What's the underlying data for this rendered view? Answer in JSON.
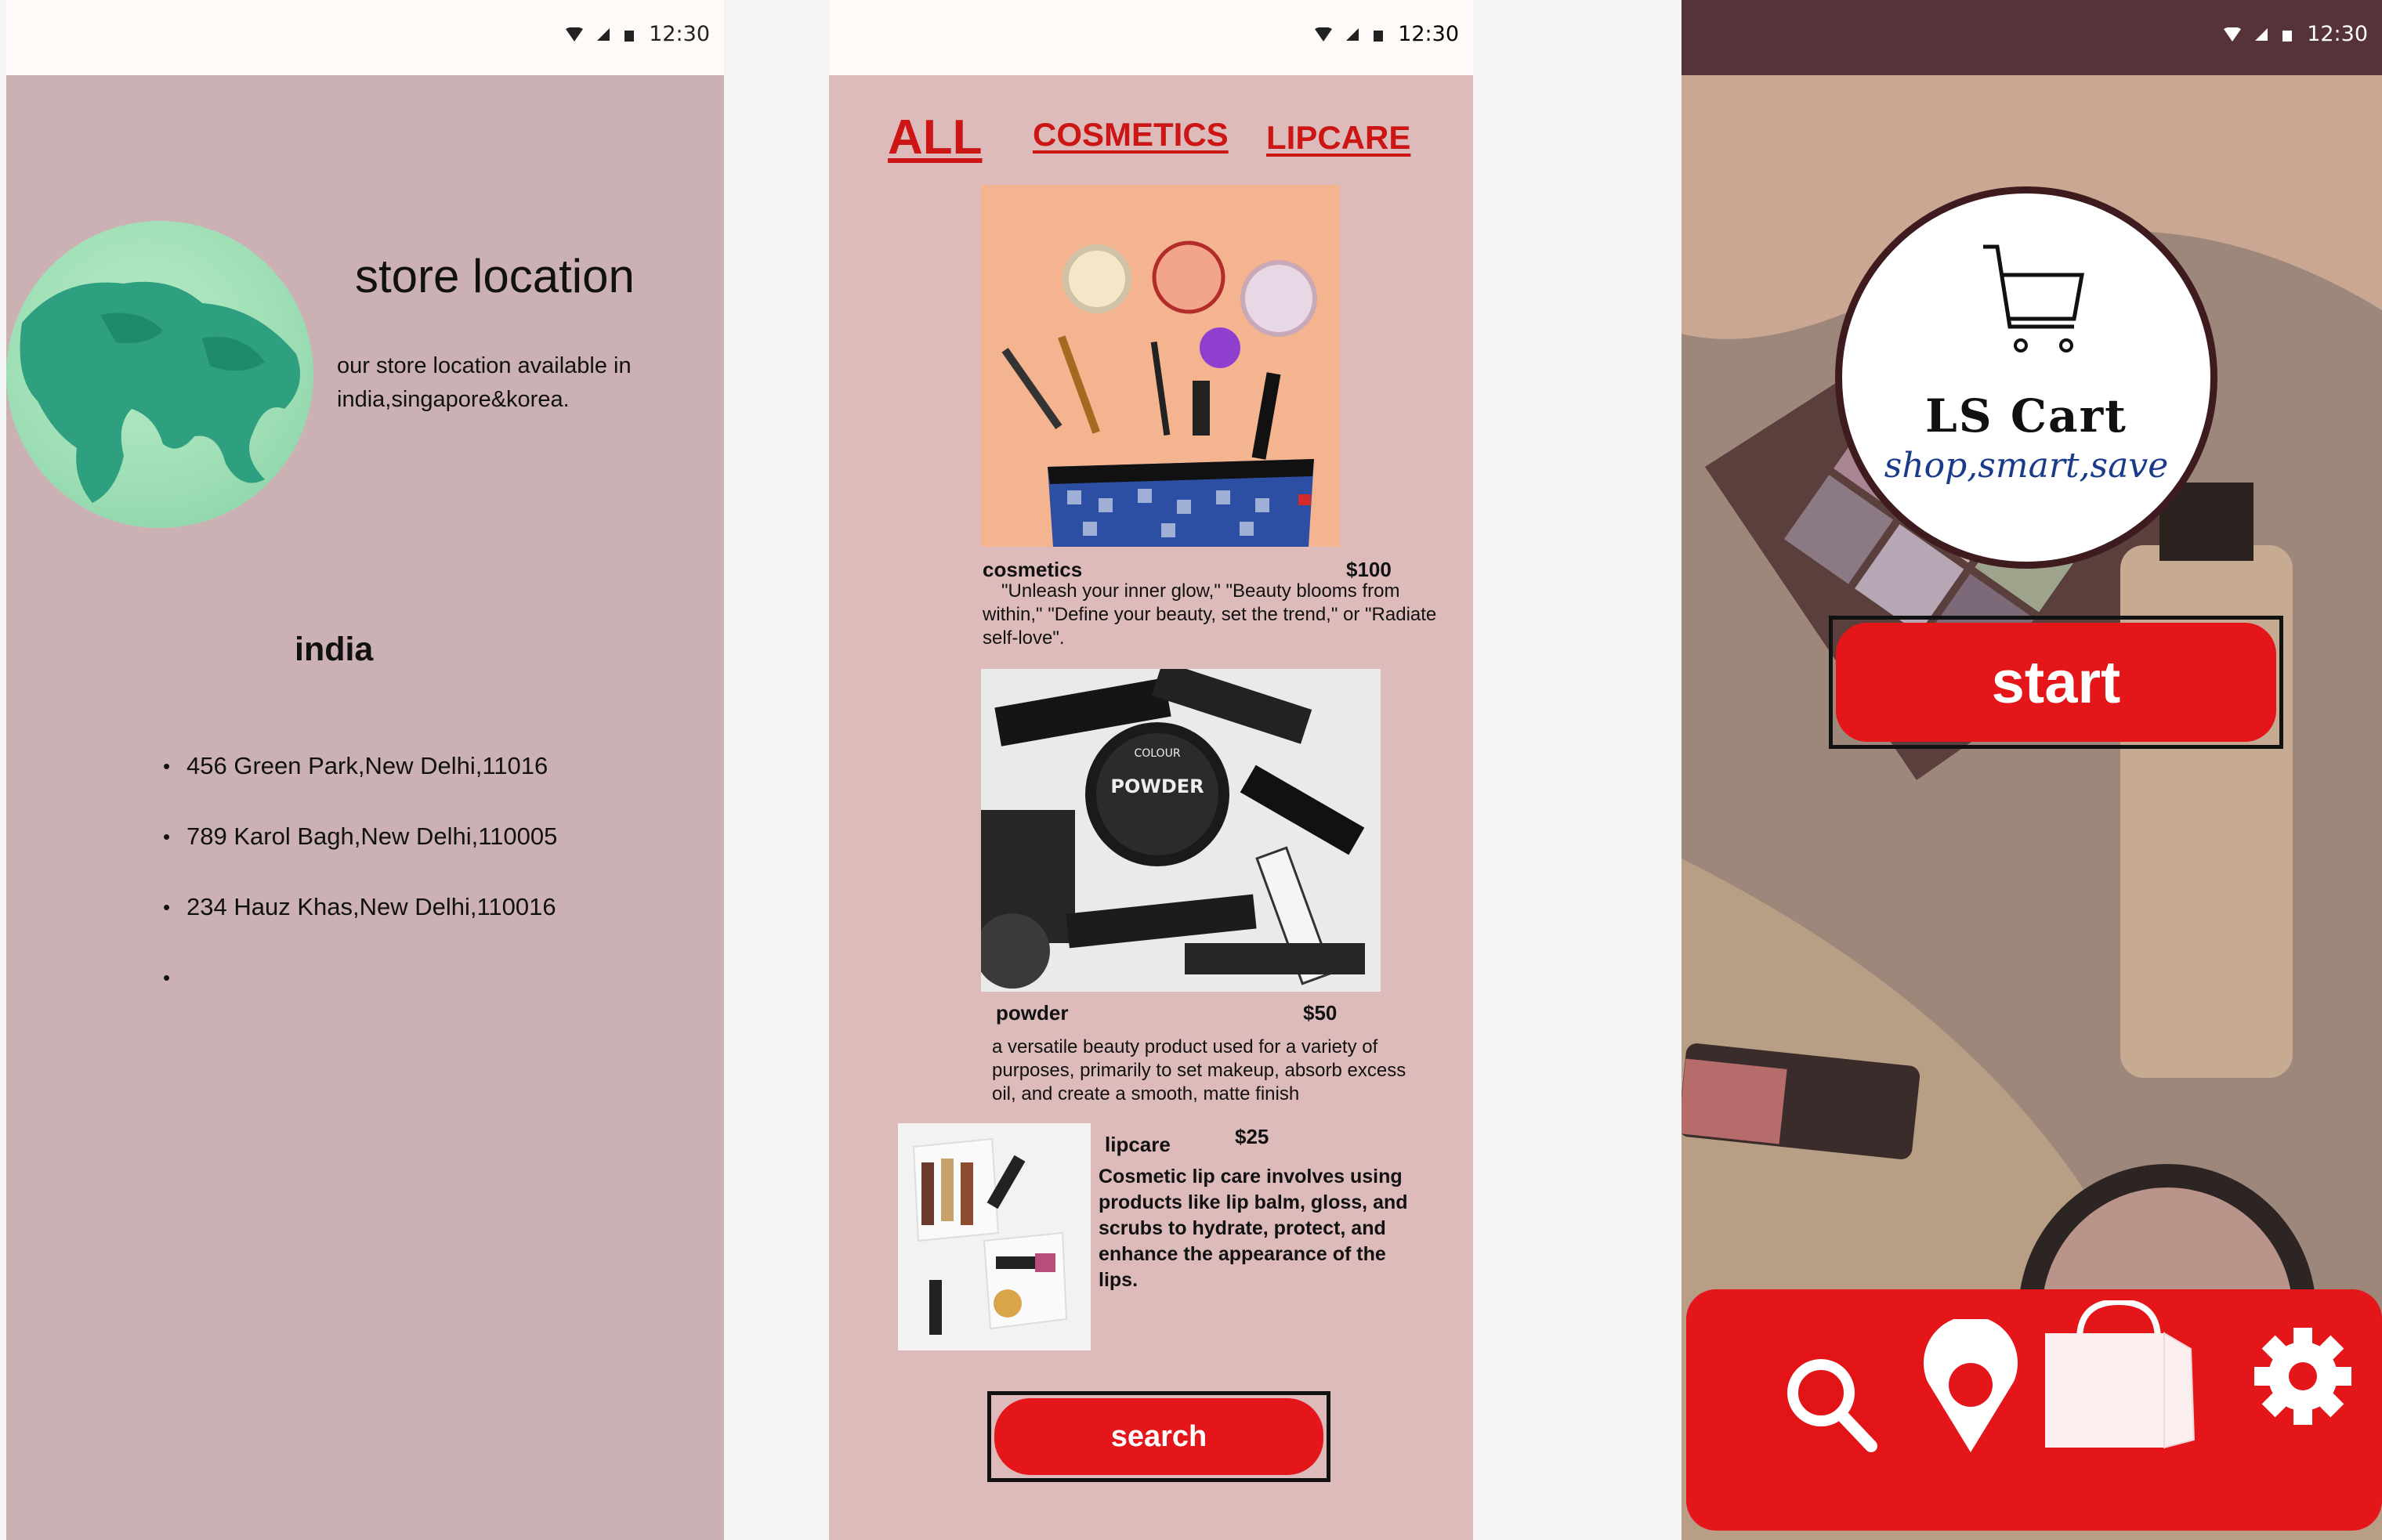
{
  "status_bar": {
    "time": "12:30"
  },
  "location_screen": {
    "title": "store location",
    "description": "our store location available in india,singapore&korea.",
    "country": "india",
    "addresses": [
      "456 Green Park,New Delhi,11016",
      "789 Karol Bagh,New Delhi,110005",
      "234 Hauz Khas,New Delhi,110016",
      ""
    ]
  },
  "products_screen": {
    "tabs": [
      "ALL",
      "COSMETICS",
      "LIPCARE"
    ],
    "products": [
      {
        "name": "cosmetics",
        "price": "$100",
        "description": "\"Unleash your inner glow,\" \"Beauty blooms from within,\" \"Define your beauty, set the trend,\" or \"Radiate self-love\"."
      },
      {
        "name": "powder",
        "price": "$50",
        "description": "a versatile beauty product used for a variety of purposes, primarily to set makeup, absorb excess oil, and create a smooth, matte finish"
      },
      {
        "name": "lipcare",
        "price": "$25",
        "description": "Cosmetic lip care involves using products like lip balm, gloss, and scrubs to hydrate, protect, and enhance the appearance of the lips."
      }
    ],
    "search_label": "search"
  },
  "start_screen": {
    "logo_title": "LS Cart",
    "logo_tagline": "shop,smart,save",
    "start_label": "start",
    "nav_icons": [
      "search-icon",
      "location-pin-icon",
      "shopping-bag-icon",
      "gear-icon"
    ]
  },
  "colors": {
    "accent_red": "#e5161a",
    "tab_red": "#cc1515",
    "location_bg": "#ccb1b4",
    "products_bg": "#ddbbbb",
    "logo_ring": "#3e1b1e"
  }
}
